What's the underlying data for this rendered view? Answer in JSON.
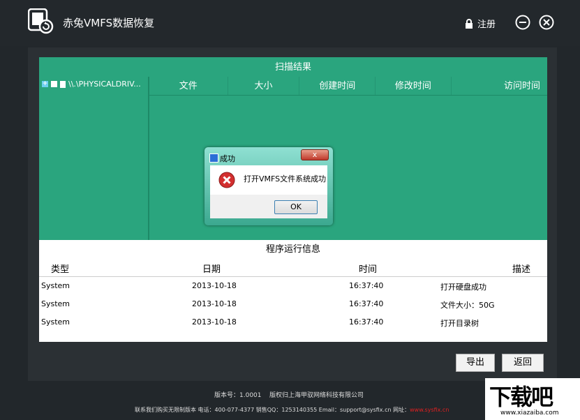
{
  "app": {
    "title": "赤兔VMFS数据恢复",
    "register_label": "注册"
  },
  "scan": {
    "header": "扫描结果",
    "tree_item": "\\\\.\\PHYSICALDRIV...",
    "columns": [
      "文件",
      "大小",
      "创建时间",
      "修改时间",
      "访问时间"
    ]
  },
  "dialog": {
    "title": "成功",
    "close_label": "x",
    "message": "打开VMFS文件系统成功",
    "ok_label": "OK"
  },
  "log": {
    "header": "程序运行信息",
    "columns": [
      "类型",
      "日期",
      "时间",
      "描述"
    ],
    "rows": [
      [
        "System",
        "2013-10-18",
        "16:37:40",
        "打开硬盘成功"
      ],
      [
        "System",
        "2013-10-18",
        "16:37:40",
        "文件大小：50G"
      ],
      [
        "System",
        "2013-10-18",
        "16:37:40",
        "打开目录树"
      ]
    ]
  },
  "buttons": {
    "export": "导出",
    "back": "返回"
  },
  "footer": {
    "version": "版本号：1.0001",
    "copyright": "版权归上海甲驭网络科技有限公司",
    "contact": "联系我们购买无限制版本  电话：400-077-4377 销售QQ：1253140355 Email：support@sysfix.cn 网址：",
    "website": "www.sysfix.cn"
  },
  "watermark": {
    "logo_text": "下载吧",
    "url": "www.xiazaiba.com"
  },
  "colors": {
    "accent_green": "#2aa57e",
    "background": "#22272b",
    "error_red": "#d32f2f"
  }
}
